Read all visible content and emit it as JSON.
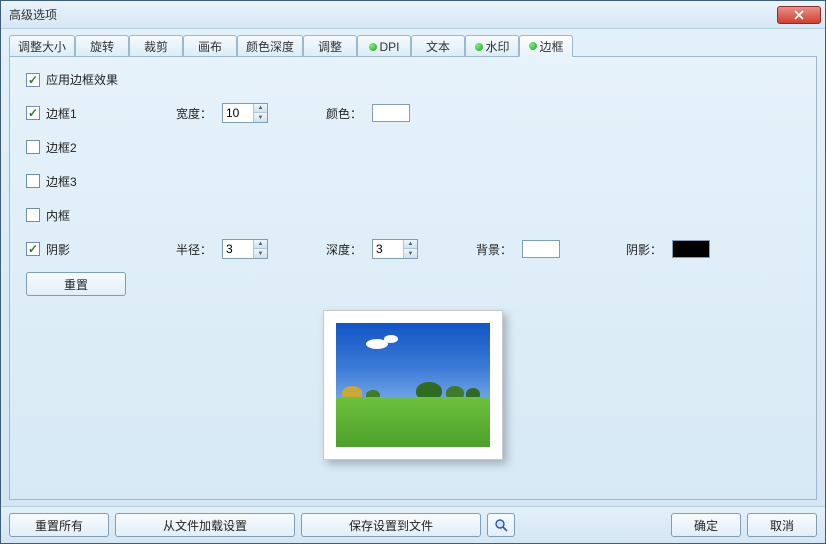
{
  "window": {
    "title": "高级选项"
  },
  "tabs": [
    {
      "label": "调整大小",
      "dot": false
    },
    {
      "label": "旋转",
      "dot": false
    },
    {
      "label": "裁剪",
      "dot": false
    },
    {
      "label": "画布",
      "dot": false
    },
    {
      "label": "颜色深度",
      "dot": false
    },
    {
      "label": "调整",
      "dot": false
    },
    {
      "label": "DPI",
      "dot": true
    },
    {
      "label": "文本",
      "dot": false
    },
    {
      "label": "水印",
      "dot": true
    },
    {
      "label": "边框",
      "dot": true,
      "active": true
    }
  ],
  "panel": {
    "apply_label": "应用边框效果",
    "apply_checked": true,
    "border1": {
      "label": "边框1",
      "checked": true
    },
    "border2": {
      "label": "边框2",
      "checked": false
    },
    "border3": {
      "label": "边框3",
      "checked": false
    },
    "inner": {
      "label": "内框",
      "checked": false
    },
    "shadow": {
      "label": "阴影",
      "checked": true
    },
    "width_label": "宽度：",
    "width_value": "10",
    "color_label": "颜色：",
    "color_value": "#ffffff",
    "radius_label": "半径：",
    "radius_value": "3",
    "depth_label": "深度：",
    "depth_value": "3",
    "bg_label": "背景：",
    "bg_value": "#ffffff",
    "shadow_color_label": "阴影：",
    "shadow_color_value": "#000000",
    "reset_label": "重置"
  },
  "buttons": {
    "reset_all": "重置所有",
    "load_from_file": "从文件加载设置",
    "save_to_file": "保存设置到文件",
    "ok": "确定",
    "cancel": "取消"
  }
}
